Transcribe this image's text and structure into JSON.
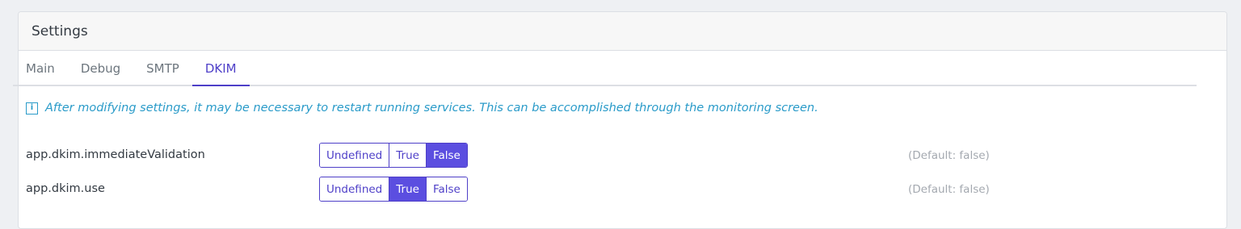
{
  "card": {
    "title": "Settings"
  },
  "tabs": [
    {
      "label": "Main",
      "active": false
    },
    {
      "label": "Debug",
      "active": false
    },
    {
      "label": "SMTP",
      "active": false
    },
    {
      "label": "DKIM",
      "active": true
    }
  ],
  "info": {
    "icon": "info-icon",
    "text": "After modifying settings, it may be necessary to restart running services. This can be accomplished through the monitoring screen."
  },
  "options": {
    "undefined": "Undefined",
    "true": "True",
    "false": "False"
  },
  "settings": [
    {
      "key": "app.dkim.immediateValidation",
      "selected": "False",
      "default": "(Default: false)"
    },
    {
      "key": "app.dkim.use",
      "selected": "True",
      "default": "(Default: false)"
    }
  ],
  "colors": {
    "accent": "#5b4ee0",
    "info": "#2a9bc9",
    "muted": "#a4a9b0"
  }
}
